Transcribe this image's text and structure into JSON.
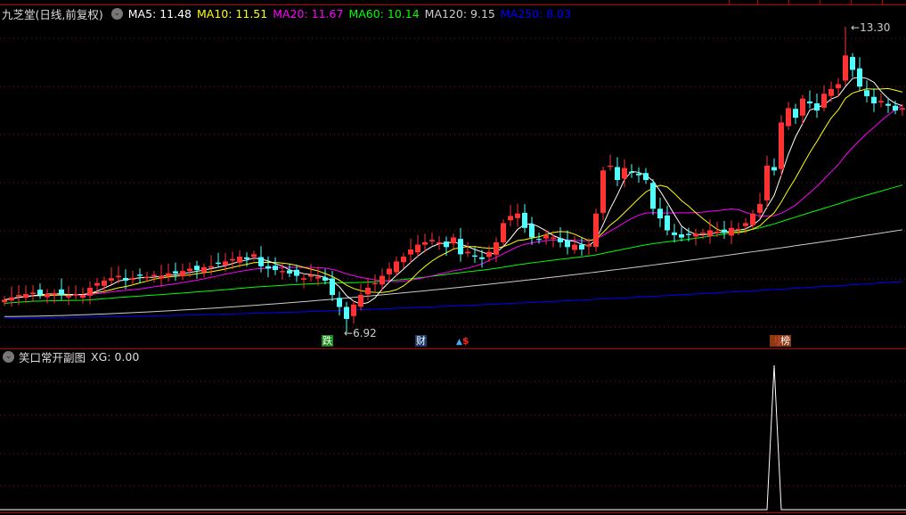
{
  "header": {
    "title": "九芝堂(日线,前复权)",
    "ma": [
      {
        "label": "MA5: 11.48",
        "color": "#ffffff"
      },
      {
        "label": "MA10: 11.51",
        "color": "#ffff00"
      },
      {
        "label": "MA20: 11.67",
        "color": "#ff00ff"
      },
      {
        "label": "MA60: 10.14",
        "color": "#00ff00"
      },
      {
        "label": "MA120: 9.15",
        "color": "#cccccc"
      },
      {
        "label": "MA250: 8.03",
        "color": "#0000ff"
      }
    ]
  },
  "annotations": {
    "high": "13.30",
    "low": "6.92"
  },
  "markers": {
    "drop": "跌",
    "finance": "财",
    "money": "$",
    "rank": "榜"
  },
  "sub": {
    "title": "笑口常开副图",
    "value": "XG: 0.00"
  },
  "colors": {
    "up": "#ff3333",
    "down": "#54ffff",
    "grid": "#8a1010"
  },
  "chart_data": {
    "type": "candlestick",
    "closes": [
      7.6,
      7.65,
      7.7,
      7.72,
      7.75,
      7.7,
      7.72,
      7.74,
      7.7,
      7.68,
      7.72,
      7.7,
      7.85,
      7.95,
      8.0,
      8.05,
      8.1,
      8.0,
      8.05,
      8.1,
      8.08,
      8.12,
      8.1,
      8.15,
      8.15,
      8.2,
      8.25,
      8.22,
      8.28,
      8.3,
      8.35,
      8.4,
      8.45,
      8.5,
      8.45,
      8.55,
      8.3,
      8.25,
      8.22,
      8.2,
      8.15,
      8.1,
      8.05,
      8.12,
      8.08,
      8.0,
      7.7,
      7.45,
      7.2,
      7.5,
      7.7,
      7.85,
      7.95,
      8.1,
      8.25,
      8.4,
      8.5,
      8.65,
      8.75,
      8.8,
      8.85,
      8.8,
      8.7,
      8.9,
      8.55,
      8.6,
      8.5,
      8.45,
      8.6,
      8.8,
      9.2,
      9.35,
      9.4,
      9.1,
      8.9,
      8.85,
      8.95,
      8.9,
      8.8,
      8.7,
      8.75,
      8.65,
      8.75,
      9.4,
      10.3,
      10.4,
      10.1,
      10.35,
      10.25,
      10.2,
      10.1,
      9.5,
      9.3,
      9.05,
      8.95,
      8.9,
      8.95,
      8.98,
      9.0,
      9.05,
      9.02,
      9.0,
      9.1,
      9.08,
      9.2,
      9.4,
      9.6,
      10.4,
      10.3,
      11.3,
      11.6,
      11.4,
      11.8,
      11.7,
      11.55,
      11.9,
      12.0,
      12.1,
      12.7,
      12.4,
      12.05,
      11.85,
      11.7,
      11.75,
      11.65,
      11.55,
      11.6
    ],
    "high_index": 118,
    "high": 13.3,
    "low_index": 48,
    "low": 6.92,
    "ma120": [
      7.25,
      9.06
    ],
    "ma250": [
      7.22,
      7.98
    ],
    "ma60_start": 7.45,
    "ma60_end": 9.95,
    "xg": {
      "spike_index": 108,
      "values_max": 1
    }
  }
}
